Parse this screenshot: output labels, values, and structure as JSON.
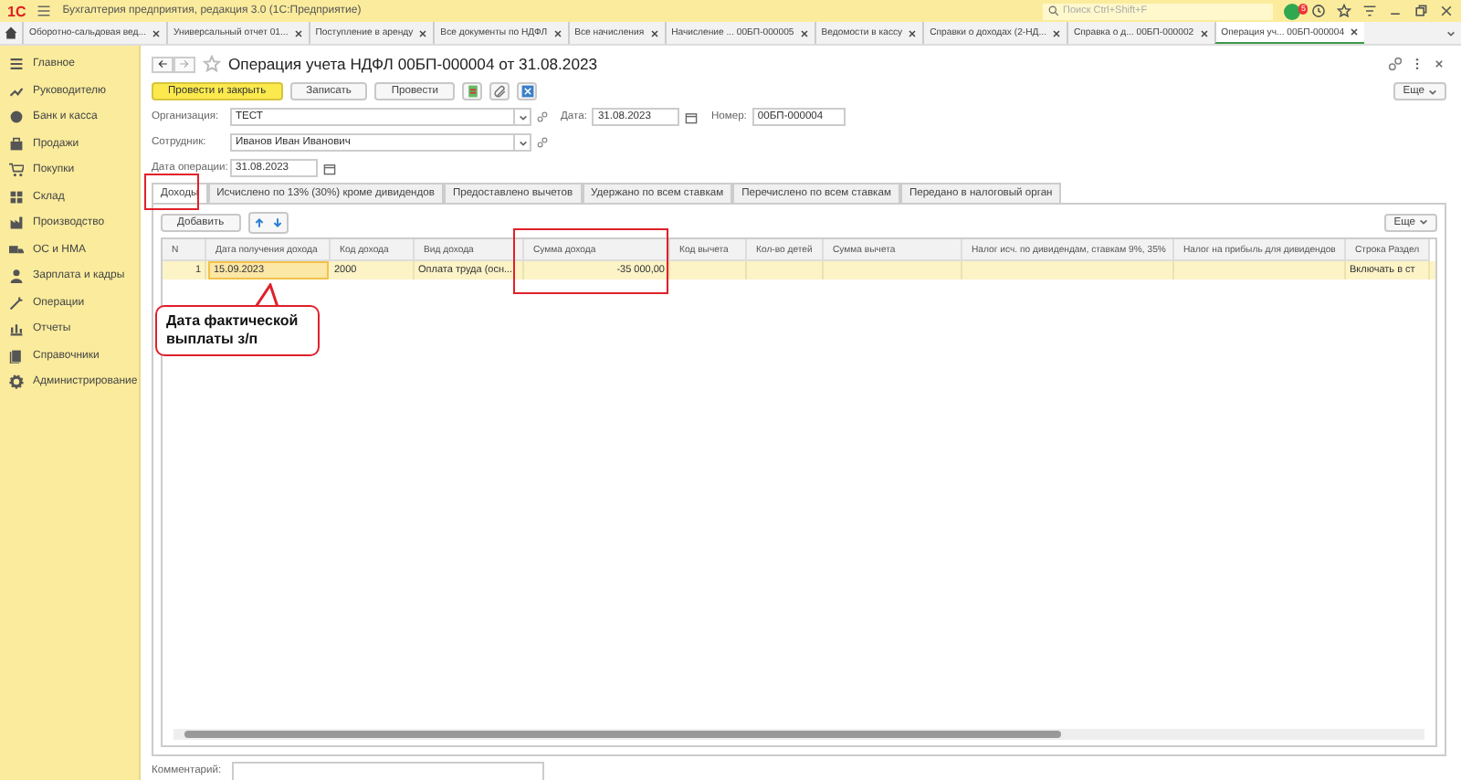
{
  "app_bar": {
    "logo": "1С",
    "title": "Бухгалтерия предприятия, редакция 3.0  (1С:Предприятие)",
    "search": {
      "placeholder": "Поиск Ctrl+Shift+F"
    },
    "notification_count": "5"
  },
  "open_tabs": [
    {
      "label": "Оборотно-сальдовая вед...",
      "selected": false
    },
    {
      "label": "Универсальный отчет 01...",
      "selected": false
    },
    {
      "label": "Поступление в аренду",
      "selected": false
    },
    {
      "label": "Все документы по НДФЛ",
      "selected": false
    },
    {
      "label": "Все начисления",
      "selected": false
    },
    {
      "label": "Начисление ... 00БП-000005",
      "selected": false
    },
    {
      "label": "Ведомости в кассу",
      "selected": false
    },
    {
      "label": "Справки о доходах (2-НД...",
      "selected": false
    },
    {
      "label": "Справка о д... 00БП-000002",
      "selected": false
    },
    {
      "label": "Операция уч... 00БП-000004",
      "selected": true
    }
  ],
  "sidebar": {
    "items": [
      {
        "label": "Главное"
      },
      {
        "label": "Руководителю"
      },
      {
        "label": "Банк и касса"
      },
      {
        "label": "Продажи"
      },
      {
        "label": "Покупки"
      },
      {
        "label": "Склад"
      },
      {
        "label": "Производство"
      },
      {
        "label": "ОС и НМА"
      },
      {
        "label": "Зарплата и кадры"
      },
      {
        "label": "Операции"
      },
      {
        "label": "Отчеты"
      },
      {
        "label": "Справочники"
      },
      {
        "label": "Администрирование"
      }
    ]
  },
  "form": {
    "title": "Операция учета НДФЛ 00БП-000004 от 31.08.2023",
    "toolbar": {
      "primary": "Провести и закрыть",
      "buttons": [
        "Записать",
        "Провести"
      ],
      "more": "Еще"
    },
    "fields": {
      "organization": {
        "label": "Организация:",
        "value": "ТЕСТ"
      },
      "date": {
        "label": "Дата:",
        "value": "31.08.2023"
      },
      "number": {
        "label": "Номер:",
        "value": "00БП-000004"
      },
      "employee": {
        "label": "Сотрудник:",
        "value": "Иванов Иван Иванович"
      },
      "operation_date": {
        "label": "Дата операции:",
        "value": "31.08.2023"
      }
    },
    "tabs": [
      {
        "label": "Доходы",
        "selected": true
      },
      {
        "label": "Исчислено по 13% (30%) кроме дивидендов",
        "selected": false
      },
      {
        "label": "Предоставлено вычетов",
        "selected": false
      },
      {
        "label": "Удержано по всем ставкам",
        "selected": false
      },
      {
        "label": "Перечислено по всем ставкам",
        "selected": false
      },
      {
        "label": "Передано в налоговый орган",
        "selected": false
      }
    ],
    "table_toolbar": {
      "add": "Добавить",
      "more": "Еще"
    },
    "table": {
      "columns": [
        "N",
        "Дата получения дохода",
        "Код дохода",
        "Вид дохода",
        "Сумма дохода",
        "Код вычета",
        "Кол-во детей",
        "Сумма вычета",
        "Налог исч. по дивидендам, ставкам 9%, 35%",
        "Налог на прибыль для дивидендов",
        "Строка Раздел"
      ],
      "rows": [
        {
          "selected": true,
          "cells": [
            "1",
            "15.09.2023",
            "2000",
            "Оплата труда (осн...",
            "-35 000,00",
            "",
            "",
            "",
            "",
            "",
            "Включать в ст"
          ]
        }
      ]
    },
    "comment": {
      "label": "Комментарий:"
    }
  },
  "annotations": {
    "callout": "Дата фактической выплаты з/п"
  }
}
